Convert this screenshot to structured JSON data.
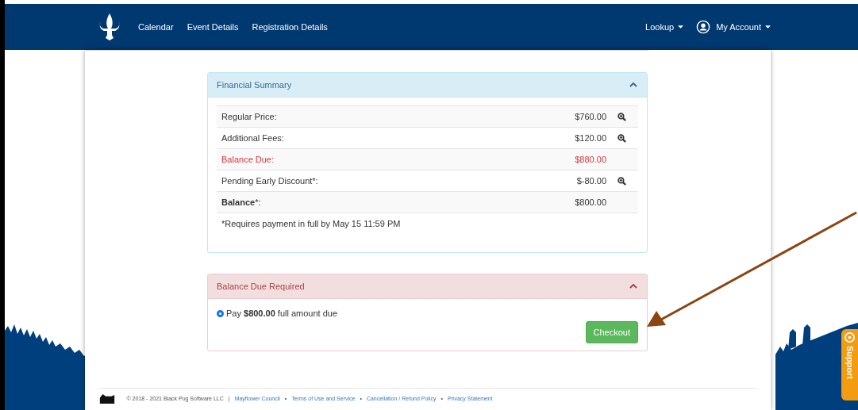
{
  "navbar": {
    "links": [
      {
        "label": "Calendar"
      },
      {
        "label": "Event Details"
      },
      {
        "label": "Registration Details"
      }
    ],
    "right": [
      {
        "label": "Lookup",
        "kind": "dropdown"
      },
      {
        "label": "My Account",
        "kind": "account"
      }
    ]
  },
  "financial_summary": {
    "title": "Financial Summary",
    "expanded": true,
    "rows": [
      {
        "label": "Regular Price:",
        "amount": "$760.00",
        "kind": "normal",
        "details": true
      },
      {
        "label": "Additional Fees:",
        "amount": "$120.00",
        "kind": "normal",
        "details": true
      },
      {
        "label": "Balance Due:",
        "amount": "$880.00",
        "kind": "due",
        "details": false
      },
      {
        "label": "Pending Early Discount*:",
        "amount": "$-80.00",
        "kind": "normal",
        "details": true
      },
      {
        "label": "**Balance***:",
        "amount": "$800.00",
        "kind": "normal",
        "details": false
      }
    ],
    "note": "*Requires payment in full by May 15 11:59 PM"
  },
  "balance_due": {
    "title": "Balance Due Required",
    "expanded": true,
    "options": [
      {
        "label": "Pay **$800.00** full amount due",
        "selected": true
      }
    ],
    "button": "Checkout"
  },
  "footer": {
    "items": [
      "© 2018 - 2021 Black Pug Software LLC",
      "|",
      "Mayflower Council",
      "•",
      "Terms of Use and Service",
      "•",
      "Cancellation / Refund Policy",
      "•",
      "Privacy Statement"
    ]
  },
  "support_tab": "Support"
}
